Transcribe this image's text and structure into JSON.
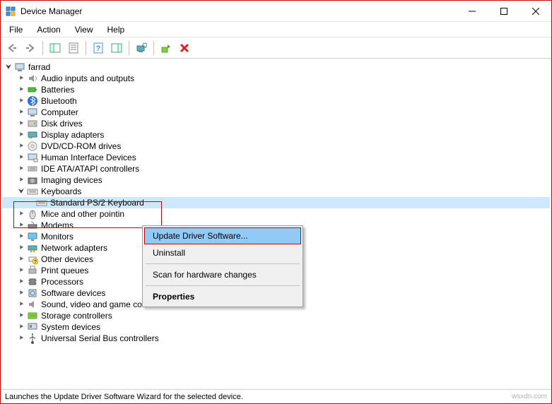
{
  "window": {
    "title": "Device Manager"
  },
  "menu": {
    "file": "File",
    "action": "Action",
    "view": "View",
    "help": "Help"
  },
  "tree": {
    "root": "farrad",
    "items": [
      "Audio inputs and outputs",
      "Batteries",
      "Bluetooth",
      "Computer",
      "Disk drives",
      "Display adapters",
      "DVD/CD-ROM drives",
      "Human Interface Devices",
      "IDE ATA/ATAPI controllers",
      "Imaging devices",
      "Keyboards",
      "Mice and other pointin",
      "Modems",
      "Monitors",
      "Network adapters",
      "Other devices",
      "Print queues",
      "Processors",
      "Software devices",
      "Sound, video and game controllers",
      "Storage controllers",
      "System devices",
      "Universal Serial Bus controllers"
    ],
    "keyboard_child": "Standard PS/2 Keyboard"
  },
  "context_menu": {
    "update": "Update Driver Software...",
    "uninstall": "Uninstall",
    "scan": "Scan for hardware changes",
    "properties": "Properties"
  },
  "statusbar": {
    "text": "Launches the Update Driver Software Wizard for the selected device."
  },
  "watermark": "wsxdn.com"
}
